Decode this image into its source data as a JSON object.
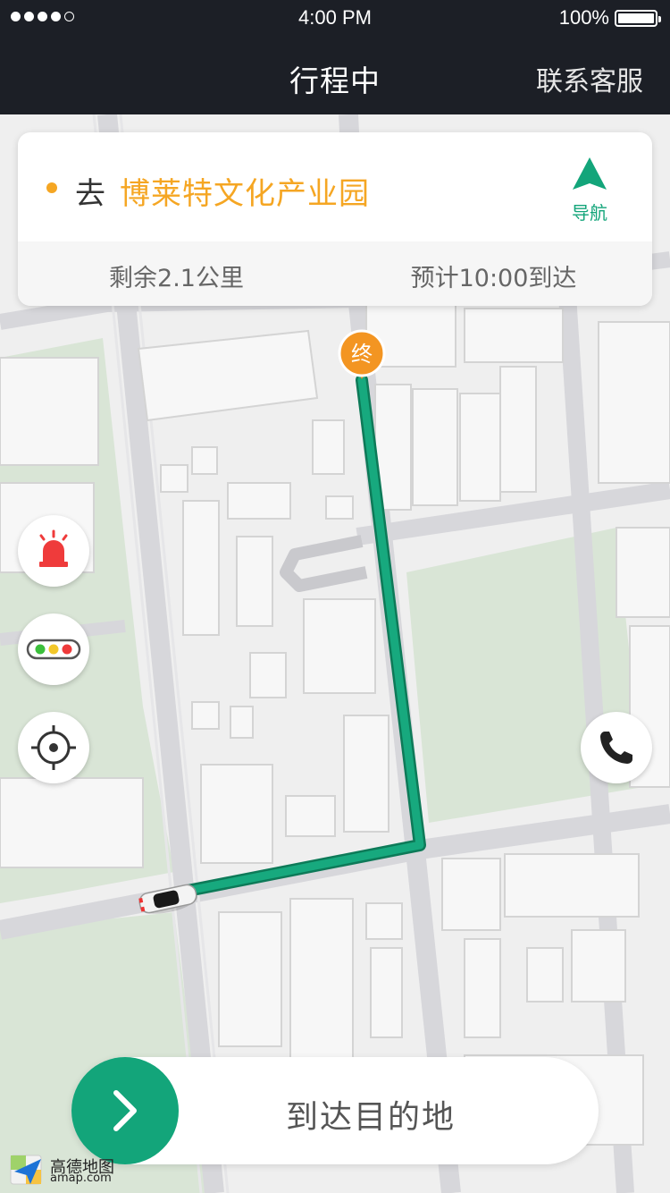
{
  "status_bar": {
    "time": "4:00 PM",
    "battery": "100%"
  },
  "header": {
    "title": "行程中",
    "contact": "联系客服"
  },
  "destination": {
    "prefix": "去",
    "name": "博莱特文化产业园",
    "navigate_label": "导航",
    "remaining": "剩余2.1公里",
    "eta": "预计10:00到达"
  },
  "map": {
    "end_marker": "终"
  },
  "controls": {
    "alarm": "alarm-icon",
    "traffic": "traffic-light-icon",
    "locate": "locate-icon",
    "phone": "phone-icon"
  },
  "action": {
    "arrive_label": "到达目的地"
  },
  "logo": {
    "name_cn": "高德地图",
    "name_en": "amap.com"
  },
  "colors": {
    "accent": "#13a57a",
    "destination": "#f5a623",
    "header_bg": "#1c1f26"
  }
}
